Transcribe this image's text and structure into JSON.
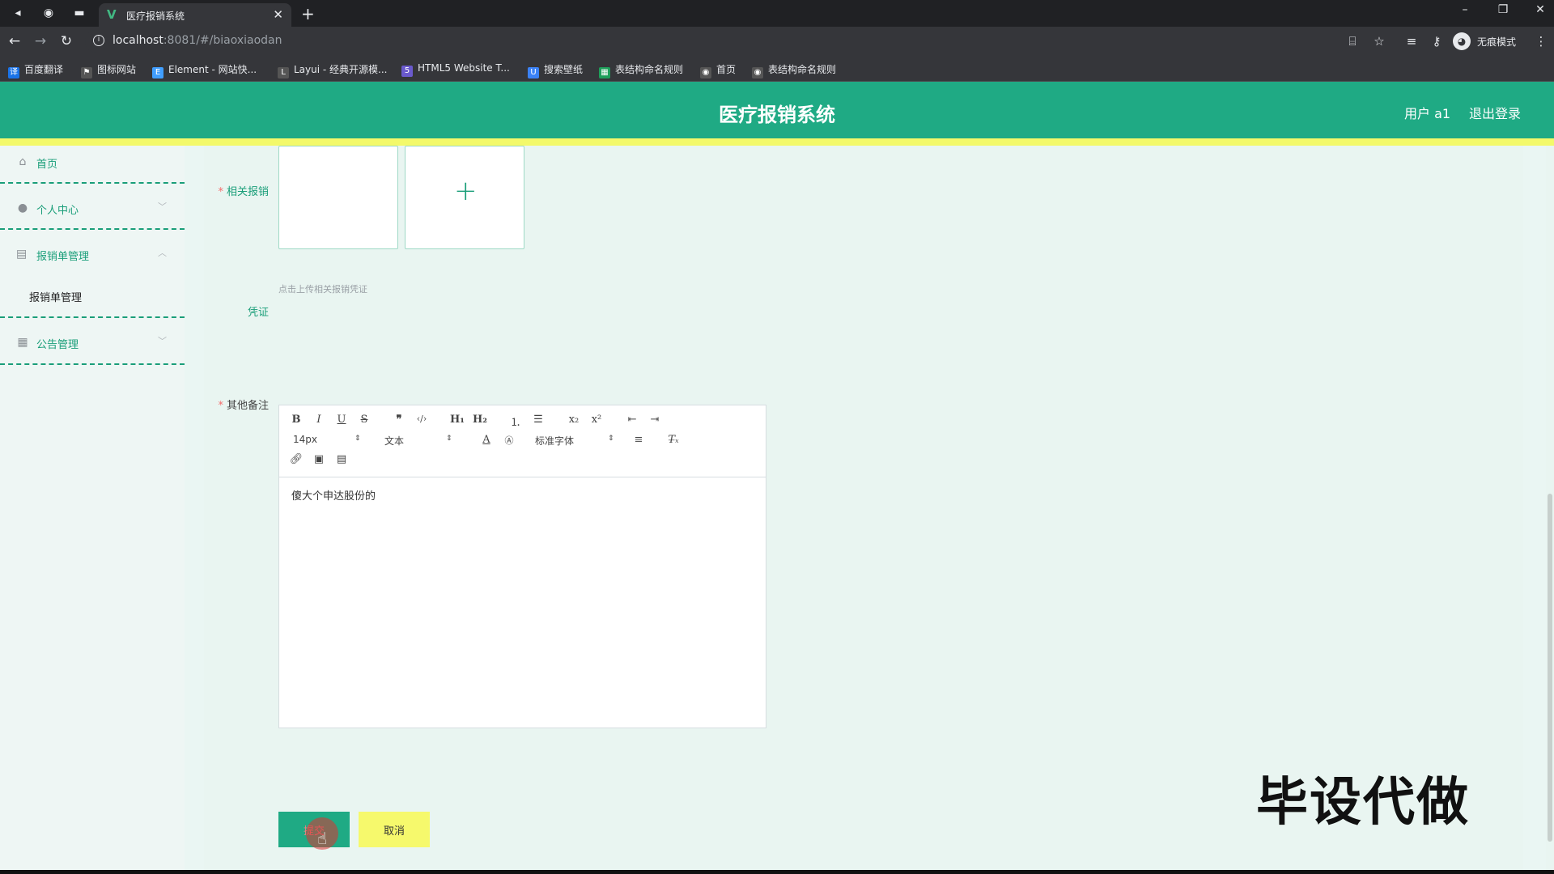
{
  "browser": {
    "tab_title": "医疗报销系统",
    "url_host": "localhost",
    "url_rest": ":8081/#/biaoxiaodan",
    "profile_label": "无痕模式",
    "bookmarks": [
      {
        "label": "百度翻译",
        "icon": "translate-icon",
        "color": "#1a73e8"
      },
      {
        "label": "图标网站",
        "icon": "flag-icon",
        "color": "#444"
      },
      {
        "label": "Element - 网站快...",
        "icon": "element-icon",
        "color": "#409eff"
      },
      {
        "label": "Layui - 经典开源模...",
        "icon": "layui-icon",
        "color": "#444"
      },
      {
        "label": "HTML5 Website T...",
        "icon": "html5-icon",
        "color": "#6a5acd"
      },
      {
        "label": "搜索壁纸",
        "icon": "wallpaper-icon",
        "color": "#3b82f6"
      },
      {
        "label": "表结构命名规则",
        "icon": "sheet-icon",
        "color": "#1e9e5a"
      },
      {
        "label": "首页",
        "icon": "globe-icon",
        "color": "#444"
      },
      {
        "label": "表结构命名规则",
        "icon": "globe-icon",
        "color": "#444"
      }
    ]
  },
  "header": {
    "title": "医疗报销系统",
    "user": "用户 a1",
    "logout": "退出登录"
  },
  "sidebar": {
    "items": [
      {
        "label": "首页",
        "icon": "home-icon"
      },
      {
        "label": "个人中心",
        "icon": "user-icon"
      },
      {
        "label": "报销单管理",
        "icon": "briefcase-icon"
      },
      {
        "label": "公告管理",
        "icon": "grid-icon"
      }
    ],
    "subitem": "报销单管理"
  },
  "form": {
    "related_label": "相关报销",
    "upload_tip": "点击上传相关报销凭证",
    "voucher_label": "凭证",
    "remarks_label": "其他备注",
    "editor_text": "傻大个申达股份的",
    "font_size": "14px",
    "header_select": "文本",
    "font_select": "标准字体",
    "submit": "提交",
    "cancel": "取消"
  },
  "watermark": "毕设代做",
  "colors": {
    "primary": "#1faa84",
    "accent": "#f3f96a"
  }
}
